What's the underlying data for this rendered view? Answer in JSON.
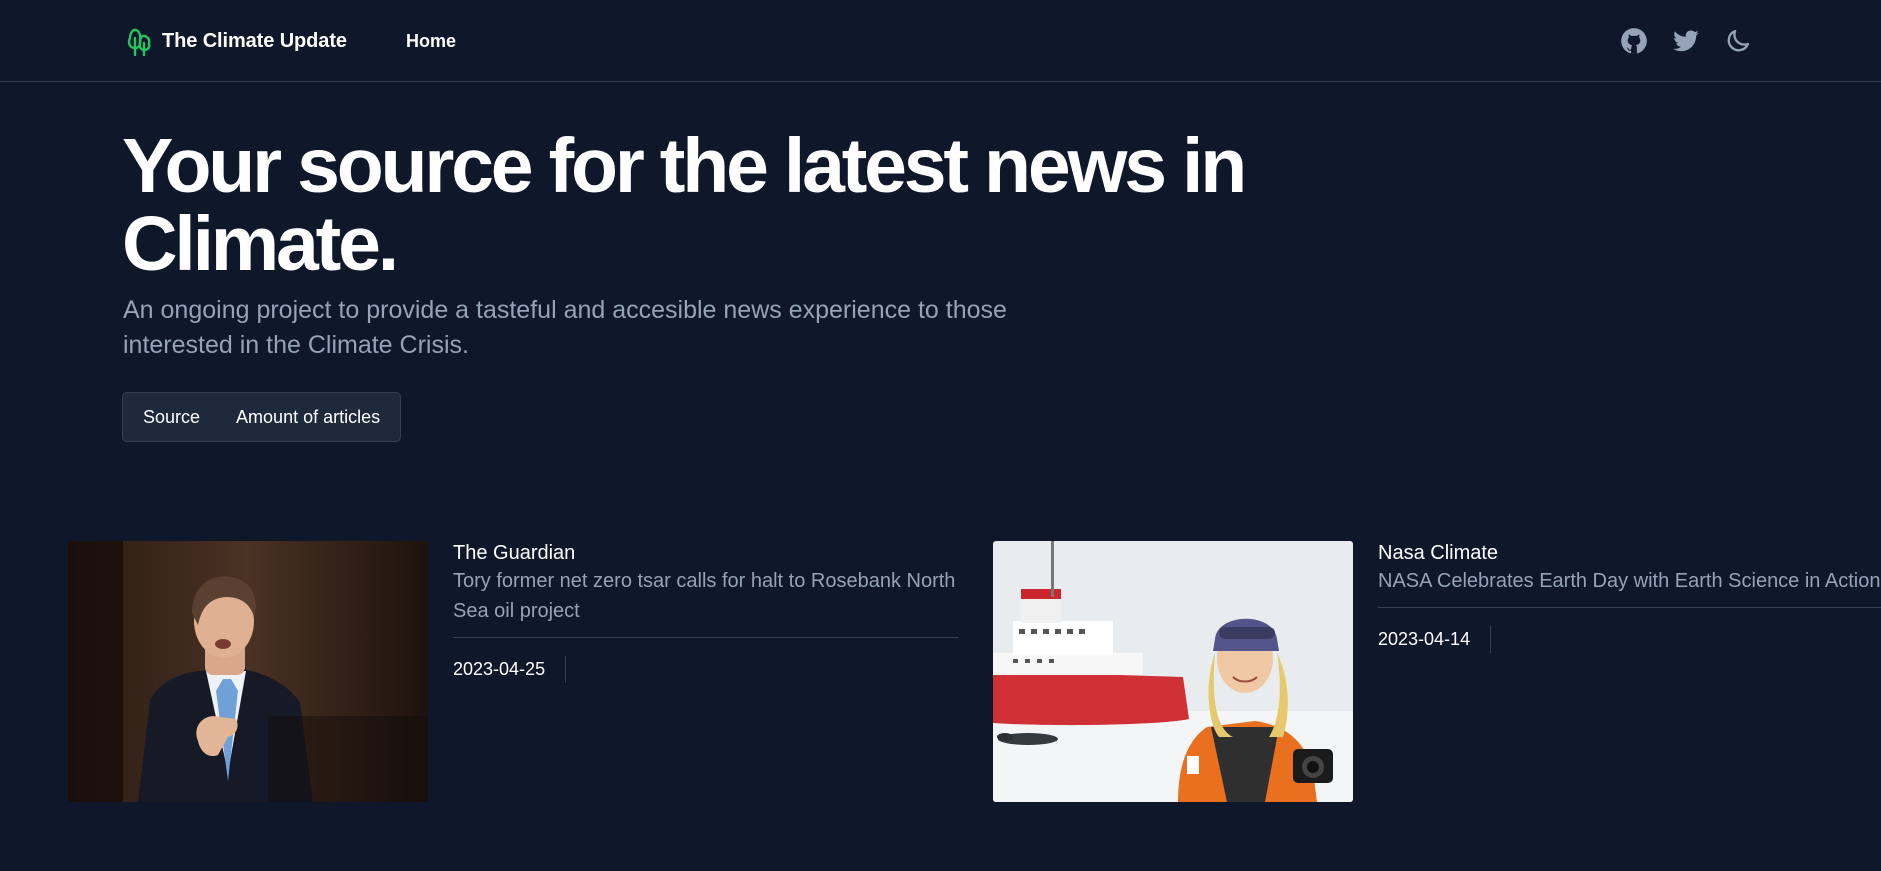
{
  "header": {
    "brand_name": "The Climate Update",
    "brand_icon": "tree-icon",
    "brand_color": "#22c55e",
    "nav_home": "Home",
    "icons": [
      "github-icon",
      "twitter-icon",
      "moon-icon"
    ]
  },
  "hero": {
    "title": "Your source for the latest news in Climate.",
    "subtitle": "An ongoing project to provide a tasteful and accesible news experience to those interested in the Climate Crisis."
  },
  "sort": {
    "source_label": "Source",
    "amount_label": "Amount of articles"
  },
  "articles": [
    {
      "source": "The Guardian",
      "title": "Tory former net zero tsar calls for halt to Rosebank North Sea oil project",
      "date": "2023-04-25"
    },
    {
      "source": "Nasa Climate",
      "title": "NASA Celebrates Earth Day with Earth Science in Action",
      "date": "2023-04-14"
    }
  ],
  "colors": {
    "background": "#0f172a",
    "muted_text": "#94a3b8",
    "border": "#334155"
  }
}
